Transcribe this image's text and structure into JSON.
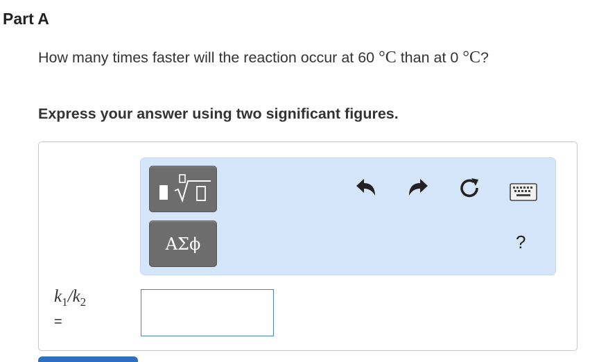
{
  "part_title": "Part A",
  "question": {
    "text_before": "How many times faster will the reaction occur at 60 ",
    "degree_c_1": "°C",
    "text_middle": " than at 0 ",
    "degree_c_2": "°C",
    "text_after": "?"
  },
  "instruction": "Express your answer using two significant figures.",
  "toolbar": {
    "greek_label": "ΑΣϕ",
    "help_label": "?"
  },
  "answer": {
    "label_k1": "k",
    "label_k1_sub": "1",
    "label_slash": "/",
    "label_k2": "k",
    "label_k2_sub": "2",
    "equals": "=",
    "value": ""
  },
  "colors": {
    "toolbar_bg": "#d6e6fa",
    "button_gray": "#6d6d6d",
    "input_border": "#4a7fc1",
    "submit_blue": "#2f6fbf"
  }
}
